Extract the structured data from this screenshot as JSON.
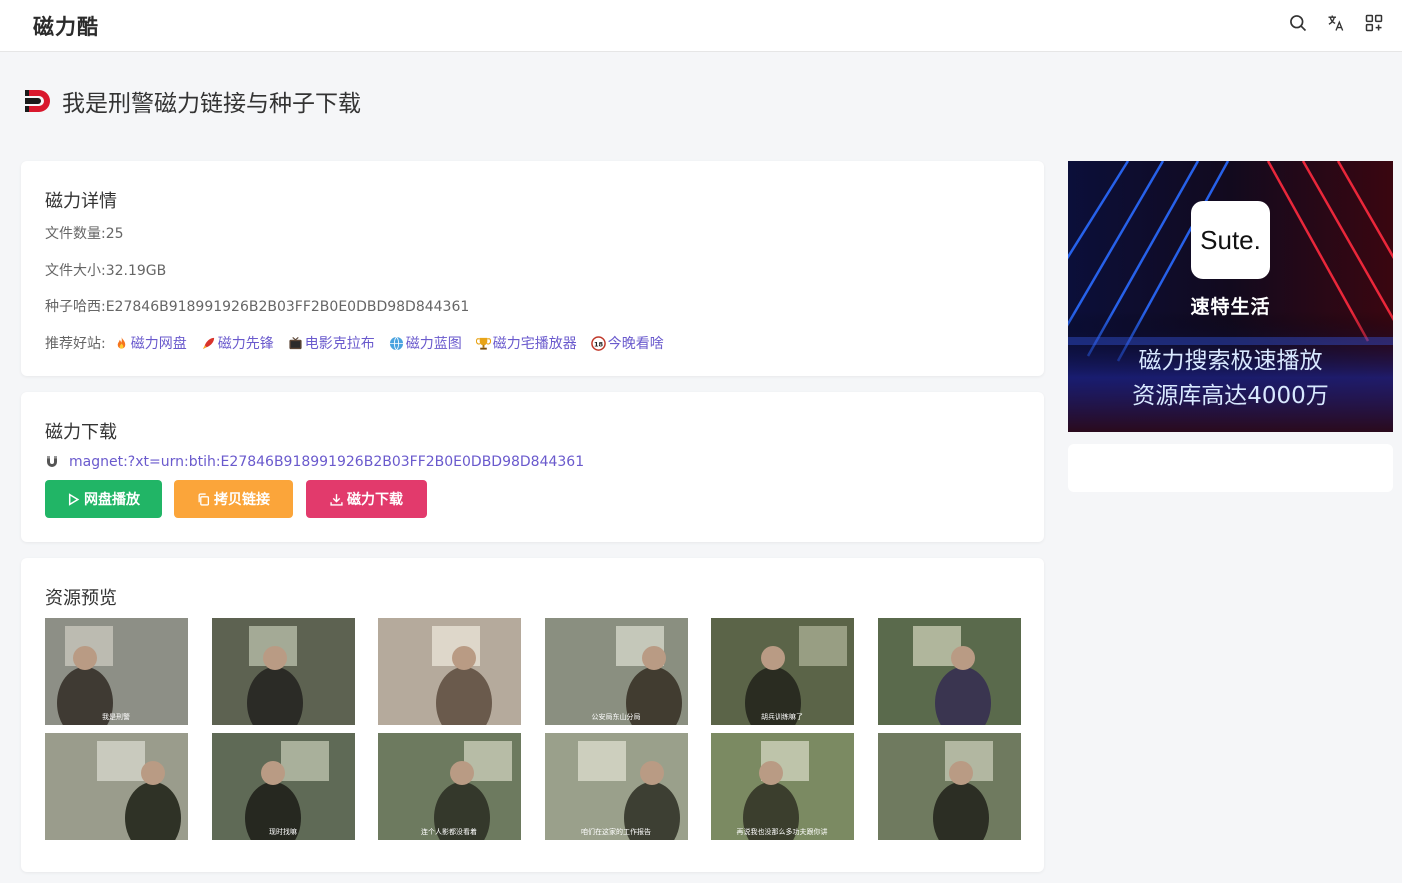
{
  "header": {
    "brand": "磁力酷",
    "icons": [
      "search-icon",
      "translate-icon",
      "apps-icon"
    ]
  },
  "page": {
    "title": "我是刑警磁力链接与种子下载"
  },
  "detail": {
    "heading": "磁力详情",
    "file_count": "文件数量:25",
    "file_size": "文件大小:32.19GB",
    "hash": "种子哈西:E27846B918991926B2B03FF2B0E0DBD98D844361",
    "rec_label": "推荐好站:",
    "rec_sites": [
      {
        "label": "磁力网盘",
        "icon": "fire-icon"
      },
      {
        "label": "磁力先锋",
        "icon": "rocket-icon"
      },
      {
        "label": "电影克拉布",
        "icon": "tv-icon"
      },
      {
        "label": "磁力蓝图",
        "icon": "globe-icon"
      },
      {
        "label": "磁力宅播放器",
        "icon": "trophy-icon"
      },
      {
        "label": "今晚看啥",
        "icon": "adult-18-icon"
      }
    ]
  },
  "download": {
    "heading": "磁力下载",
    "magnet": "magnet:?xt=urn:btih:E27846B918991926B2B03FF2B0E0DBD98D844361",
    "btn_play": "网盘播放",
    "btn_copy": "拷贝链接",
    "btn_download": "磁力下载"
  },
  "preview": {
    "heading": "资源预览",
    "thumbnails": [
      {
        "caption": "我是刑警"
      },
      {
        "caption": ""
      },
      {
        "caption": ""
      },
      {
        "caption": "公安局东山分局"
      },
      {
        "caption": "胡兵训练嘛了"
      },
      {
        "caption": ""
      },
      {
        "caption": ""
      },
      {
        "caption": "现时找嘛"
      },
      {
        "caption": "连个人影都没看着"
      },
      {
        "caption": "咱们在这家的工作报告"
      },
      {
        "caption": "再说我也没那么多功夫跟你讲"
      },
      {
        "caption": ""
      }
    ]
  },
  "ad": {
    "logo": "Sute.",
    "brand": "速特生活",
    "line1": "磁力搜索极速播放",
    "line2": "资源库高达4000万"
  },
  "colors": {
    "accent_link": "#6a5acd",
    "green": "#21b566",
    "orange": "#fba53a",
    "pink": "#e23a6c",
    "logo_red": "#d9182d"
  }
}
